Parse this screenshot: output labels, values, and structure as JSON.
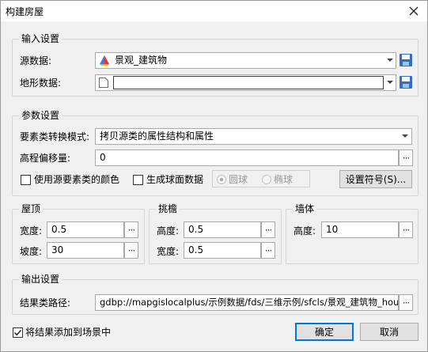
{
  "window": {
    "title": "构建房屋"
  },
  "input_settings": {
    "title": "输入设置",
    "source_label": "源数据:",
    "source_value": "景观_建筑物",
    "terrain_label": "地形数据:",
    "terrain_value": ""
  },
  "param_settings": {
    "title": "参数设置",
    "mode_label": "要素类转换模式:",
    "mode_value": "拷贝源类的属性结构和属性",
    "offset_label": "高程偏移量:",
    "offset_value": "0",
    "use_color_label": "使用源要素类的颜色",
    "sphere_label": "生成球面数据",
    "radio_sphere": "圆球",
    "radio_ellipsoid": "椭球",
    "symbol_button": "设置符号(S)..."
  },
  "roof": {
    "title": "屋顶",
    "width_label": "宽度:",
    "width_value": "0.5",
    "slope_label": "坡度:",
    "slope_value": "30"
  },
  "eaves": {
    "title": "挑檐",
    "height_label": "高度:",
    "height_value": "0.5",
    "width_label": "宽度:",
    "width_value": "0.5"
  },
  "wall": {
    "title": "墙体",
    "height_label": "高度:",
    "height_value": "10"
  },
  "output_settings": {
    "title": "输出设置",
    "path_label": "结果类路径:",
    "path_value": "gdbp://mapgislocalplus/示例数据/fds/三维示例/sfcls/景观_建筑物_hou"
  },
  "footer": {
    "add_to_scene_label": "将结果添加到场景中",
    "add_to_scene_checked": true,
    "ok_button": "确定",
    "cancel_button": "取消"
  },
  "icons": {
    "close": "close-icon",
    "layer": "layer-icon",
    "blank_file": "blank-file-icon",
    "save": "save-icon",
    "dropdown": "chevron-down-icon",
    "checkmark": "checkmark-icon"
  }
}
